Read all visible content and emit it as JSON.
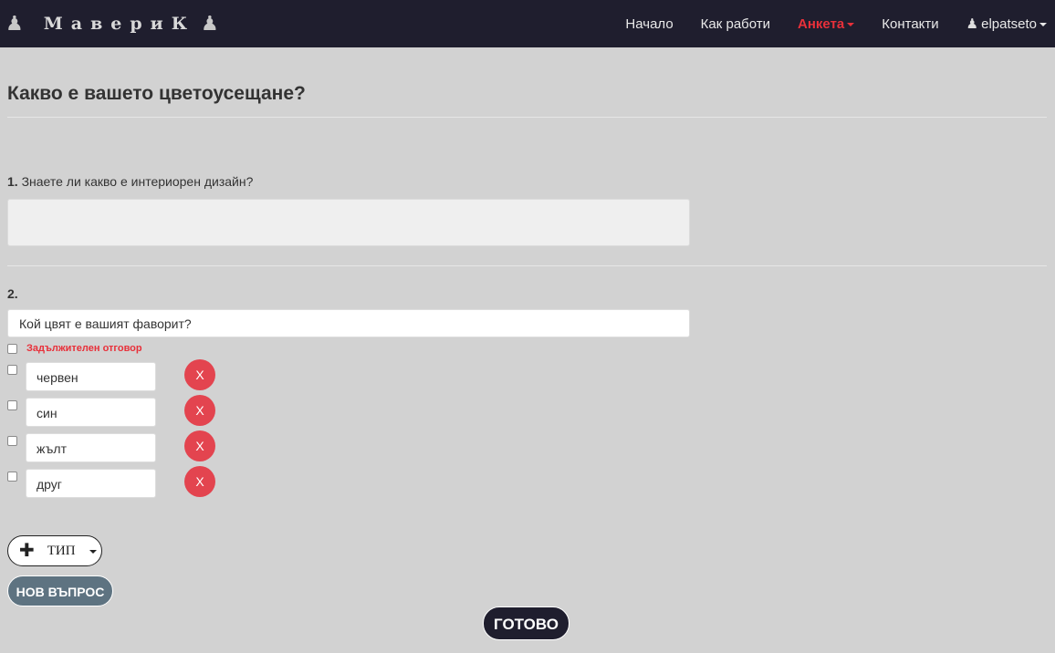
{
  "navbar": {
    "brand": "МавериК",
    "brand_icon": "chess-pawn-icon",
    "items": [
      {
        "label": "Начало"
      },
      {
        "label": "Как работи"
      },
      {
        "label": "Анкета",
        "active": true
      },
      {
        "label": "Контакти"
      }
    ],
    "user": "elpatseto",
    "accent_color": "#e8303a"
  },
  "survey": {
    "title": "Какво е вашето цветоусещане?",
    "q1": {
      "number": "1.",
      "text": "Знаете ли какво е интериорен дизайн?"
    },
    "q2": {
      "number": "2.",
      "question_value": "Кой цвят е вашият фаворит?",
      "required_label": "Задължителен отговор",
      "options": [
        {
          "value": "червен",
          "delete_label": "X"
        },
        {
          "value": "син",
          "delete_label": "X"
        },
        {
          "value": "жълт",
          "delete_label": "X"
        },
        {
          "value": "друг",
          "delete_label": "X"
        }
      ]
    }
  },
  "actions": {
    "add_icon": "plus-icon",
    "type_label": "ТИП",
    "new_question": "НОВ ВЪПРОС",
    "done": "ГОТОВО"
  }
}
